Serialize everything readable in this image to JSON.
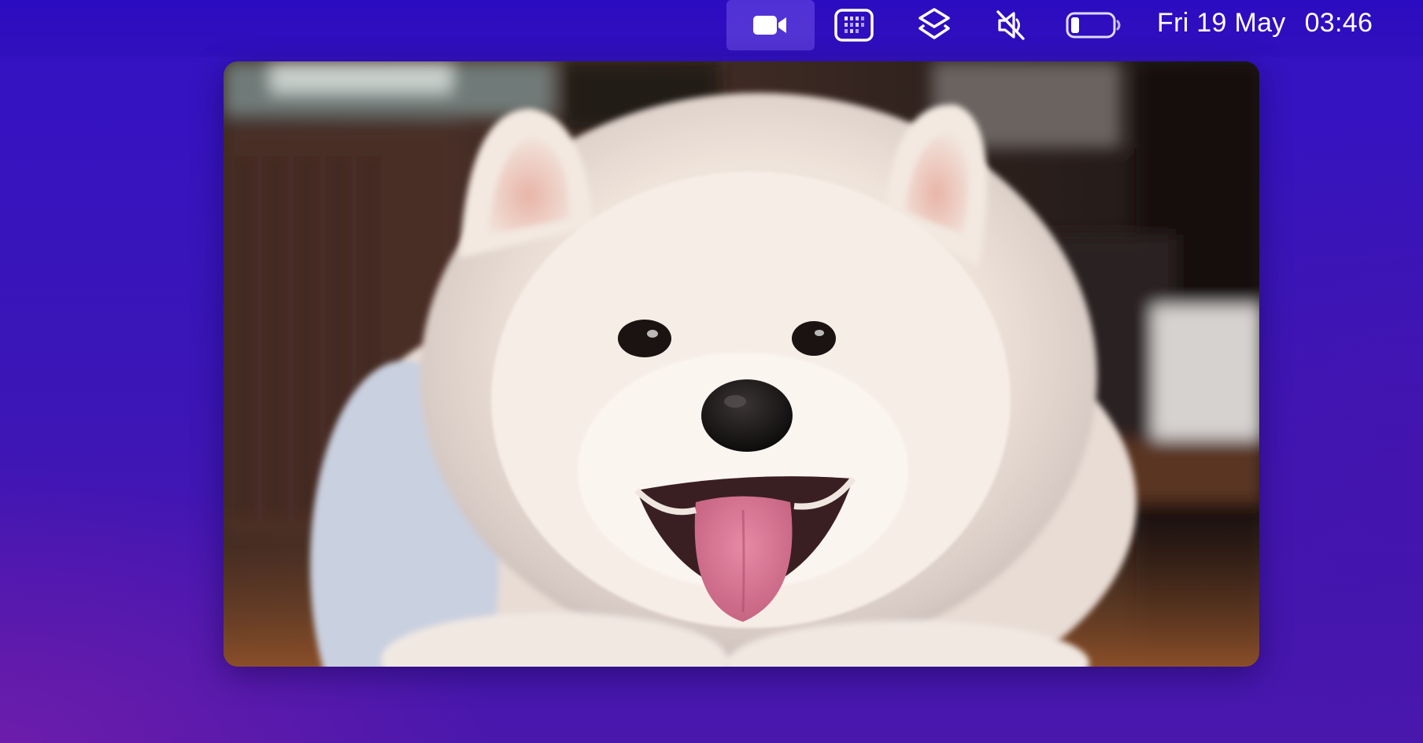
{
  "menubar": {
    "icons": [
      {
        "name": "video-camera-icon",
        "active": true
      },
      {
        "name": "screen-grid-icon",
        "active": false
      },
      {
        "name": "layers-icon",
        "active": false
      },
      {
        "name": "speaker-muted-icon",
        "active": false
      },
      {
        "name": "battery-icon",
        "active": false
      }
    ],
    "battery_level": 0.2,
    "date": "Fri 19 May",
    "time": "03:46"
  },
  "photo": {
    "subject": "white-fluffy-puppy-photo"
  },
  "colors": {
    "background": "#3a15b8",
    "menubar": "#2e0ec0",
    "active_highlight": "#6a55e8",
    "icon": "#ffffff"
  }
}
